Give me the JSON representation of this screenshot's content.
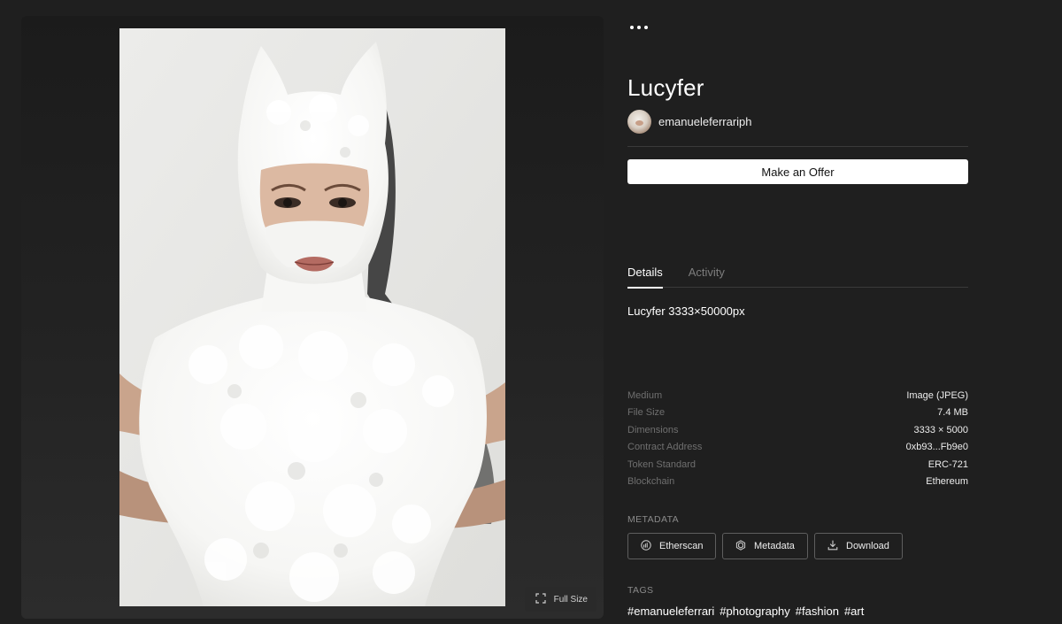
{
  "artwork": {
    "full_size_label": "Full Size"
  },
  "header": {
    "more_icon": "more-horizontal-icon"
  },
  "token": {
    "title": "Lucyfer",
    "creator": "emanueleferrariph",
    "offer_button": "Make an Offer",
    "description": "Lucyfer 3333×50000px"
  },
  "tabs": [
    {
      "label": "Details",
      "active": true
    },
    {
      "label": "Activity",
      "active": false
    }
  ],
  "properties": [
    {
      "key": "Medium",
      "value": "Image (JPEG)"
    },
    {
      "key": "File Size",
      "value": "7.4 MB"
    },
    {
      "key": "Dimensions",
      "value": "3333 × 5000"
    },
    {
      "key": "Contract Address",
      "value": "0xb93...Fb9e0"
    },
    {
      "key": "Token Standard",
      "value": "ERC-721"
    },
    {
      "key": "Blockchain",
      "value": "Ethereum"
    }
  ],
  "metadata": {
    "label": "METADATA",
    "buttons": [
      {
        "label": "Etherscan",
        "icon": "etherscan-icon"
      },
      {
        "label": "Metadata",
        "icon": "hexagon-icon"
      },
      {
        "label": "Download",
        "icon": "download-icon"
      }
    ]
  },
  "tags": {
    "label": "TAGS",
    "items": [
      "#emanueleferrari",
      "#photography",
      "#fashion",
      "#art"
    ]
  },
  "colors": {
    "background": "#1f1f1f",
    "stage": "#232323",
    "offer_button_bg": "#ffffff",
    "muted_text": "#6f6f6f"
  }
}
